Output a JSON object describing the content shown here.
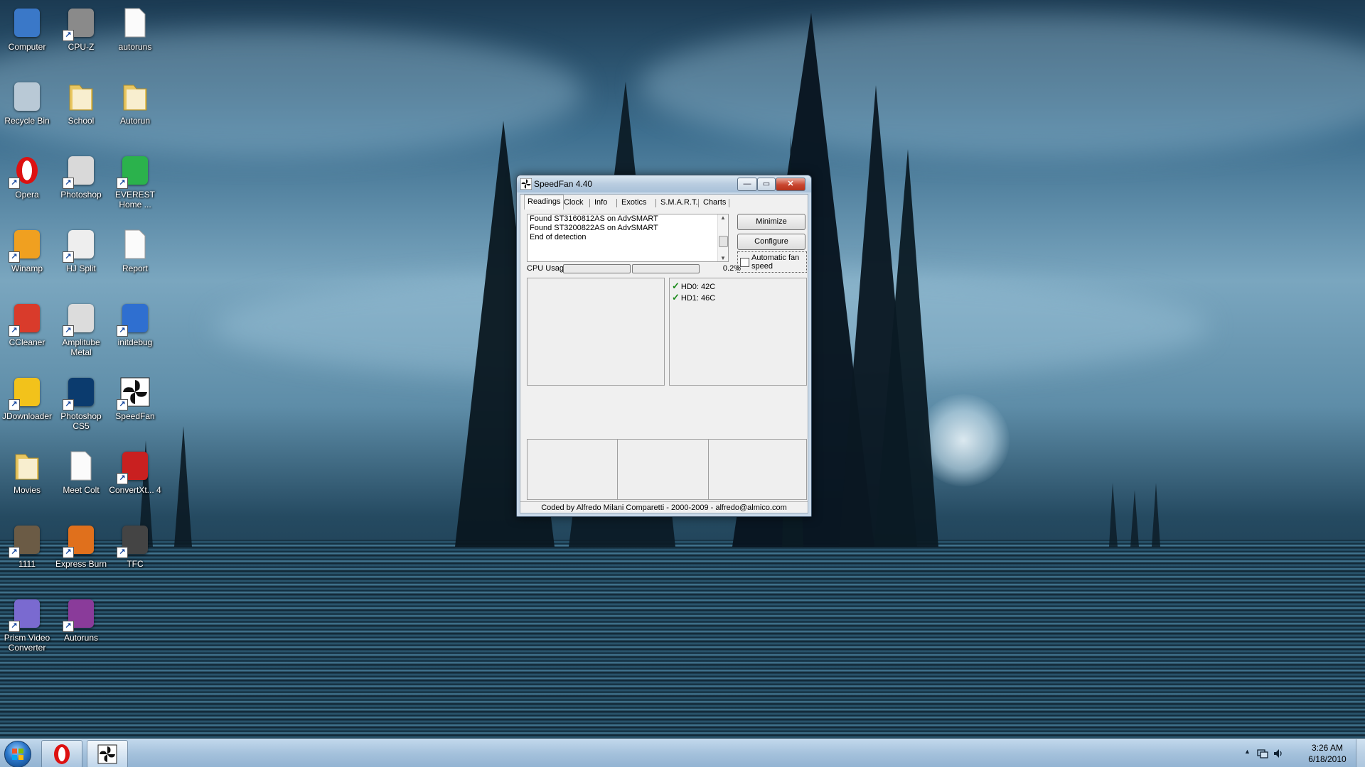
{
  "desktop": {
    "icons": [
      {
        "label": "Computer",
        "icon": "computer-icon"
      },
      {
        "label": "CPU-Z",
        "icon": "cpuz-icon"
      },
      {
        "label": "autoruns",
        "icon": "file-icon"
      },
      {
        "label": "Recycle Bin",
        "icon": "recycle-bin-icon"
      },
      {
        "label": "School",
        "icon": "folder-icon"
      },
      {
        "label": "Autorun",
        "icon": "folder-icon"
      },
      {
        "label": "Opera",
        "icon": "opera-icon"
      },
      {
        "label": "Photoshop",
        "icon": "photoshop-shortcut-icon"
      },
      {
        "label": "EVEREST Home ...",
        "icon": "everest-icon"
      },
      {
        "label": "Winamp",
        "icon": "winamp-icon"
      },
      {
        "label": "HJ Split",
        "icon": "hjsplit-icon"
      },
      {
        "label": "Report",
        "icon": "file-icon"
      },
      {
        "label": "CCleaner",
        "icon": "ccleaner-icon"
      },
      {
        "label": "Amplitube Metal",
        "icon": "amplitube-icon"
      },
      {
        "label": "initdebug",
        "icon": "monitor-icon"
      },
      {
        "label": "JDownloader",
        "icon": "jdownloader-icon"
      },
      {
        "label": "Photoshop CS5",
        "icon": "ps-icon"
      },
      {
        "label": "SpeedFan",
        "icon": "fan-icon"
      },
      {
        "label": "Movies",
        "icon": "folder-icon"
      },
      {
        "label": "Meet Colt",
        "icon": "file-icon"
      },
      {
        "label": "ConvertXt... 4",
        "icon": "convertx-icon"
      },
      {
        "label": "1111",
        "icon": "image-icon"
      },
      {
        "label": "Express Burn",
        "icon": "burn-icon"
      },
      {
        "label": "TFC",
        "icon": "trash-can-icon"
      },
      {
        "label": "Prism Video Converter",
        "icon": "prism-icon"
      },
      {
        "label": "Autoruns",
        "icon": "archive-icon"
      }
    ]
  },
  "speedfan": {
    "title": "SpeedFan 4.40",
    "tabs": [
      "Readings",
      "Clock",
      "Info",
      "Exotics",
      "S.M.A.R.T.",
      "Charts"
    ],
    "active_tab": "Readings",
    "log_lines": [
      "Found ST3160812AS on AdvSMART",
      "Found ST3200822AS on AdvSMART",
      "End of detection"
    ],
    "buttons": {
      "minimize": "Minimize",
      "configure": "Configure"
    },
    "auto_fan_label": "Automatic fan speed",
    "auto_fan_checked": false,
    "cpu_usage_label": "CPU Usage",
    "cpu_usage_value": "0.2%",
    "temps": [
      "HD0: 42C",
      "HD1: 46C"
    ],
    "credits": "Coded by Alfredo Milani Comparetti - 2000-2009 - alfredo@almico.com",
    "window_controls": {
      "minimize": "—",
      "maximize": "▭",
      "close": "✕"
    }
  },
  "taskbar": {
    "pinned": [
      {
        "name": "opera-taskbar-button",
        "icon": "opera-icon"
      },
      {
        "name": "speedfan-taskbar-button",
        "icon": "fan-icon"
      }
    ],
    "clock_time": "3:26 AM",
    "clock_date": "6/18/2010",
    "tray_arrow": "▲"
  }
}
